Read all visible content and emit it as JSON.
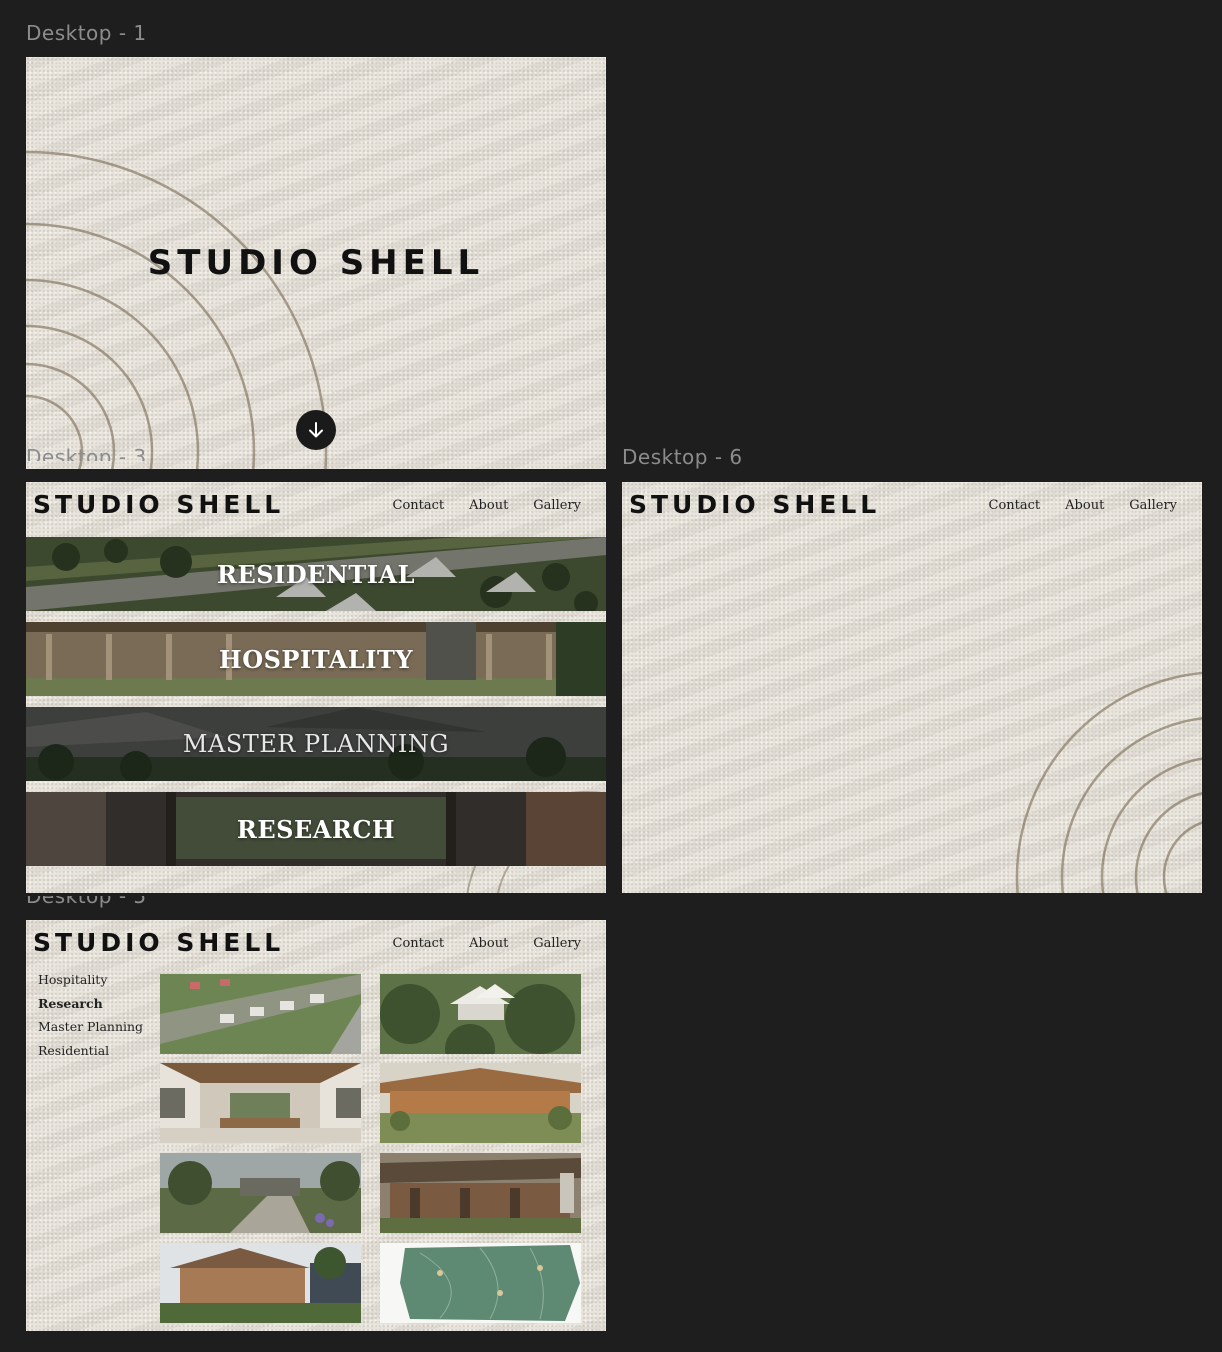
{
  "frames": {
    "desktop1": {
      "label": "Desktop - 1"
    },
    "desktop3": {
      "label": "Desktop - 3"
    },
    "desktop6": {
      "label": "Desktop - 6"
    },
    "desktop5": {
      "label": "Desktop - 5"
    }
  },
  "brand": {
    "name": "STUDIO SHELL"
  },
  "nav": {
    "contact": "Contact",
    "about": "About",
    "gallery": "Gallery"
  },
  "categories": {
    "residential": "RESIDENTIAL",
    "hospitality": "HOSPITALITY",
    "master_planning": "MASTER PLANNING",
    "research": "RESEARCH"
  },
  "filters": {
    "items": [
      "Hospitality",
      "Research",
      "Master Planning",
      "Residential"
    ],
    "active": "Research"
  },
  "icons": {
    "scroll_down": "arrow-down-icon"
  },
  "colors": {
    "canvas": "#1e1e1e",
    "sand": "#e6e2d9",
    "ink": "#111111",
    "label": "#8c8c8c"
  }
}
